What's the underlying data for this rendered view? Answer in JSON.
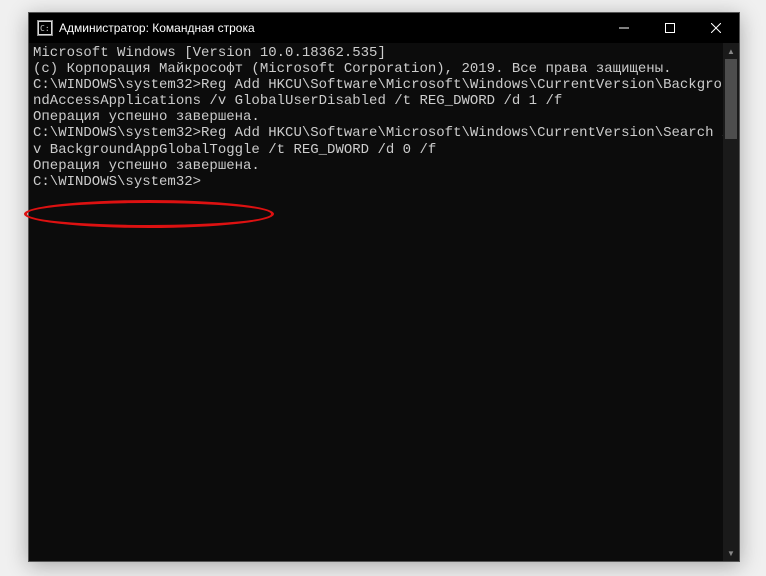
{
  "window": {
    "title": "Администратор: Командная строка"
  },
  "terminal": {
    "version_line": "Microsoft Windows [Version 10.0.18362.535]",
    "copyright_line": "(c) Корпорация Майкрософт (Microsoft Corporation), 2019. Все права защищены.",
    "blank": "",
    "cmd1_prompt": "C:\\WINDOWS\\system32>",
    "cmd1_text": "Reg Add HKCU\\Software\\Microsoft\\Windows\\CurrentVersion\\BackgroundAccessApplications /v GlobalUserDisabled /t REG_DWORD /d 1 /f",
    "cmd1_result": "Операция успешно завершена.",
    "cmd2_prompt": "C:\\WINDOWS\\system32>",
    "cmd2_text": "Reg Add HKCU\\Software\\Microsoft\\Windows\\CurrentVersion\\Search /v BackgroundAppGlobalToggle /t REG_DWORD /d 0 /f",
    "cmd2_result": "Операция успешно завершена.",
    "cmd3_prompt": "C:\\WINDOWS\\system32>",
    "cmd3_text": ""
  }
}
